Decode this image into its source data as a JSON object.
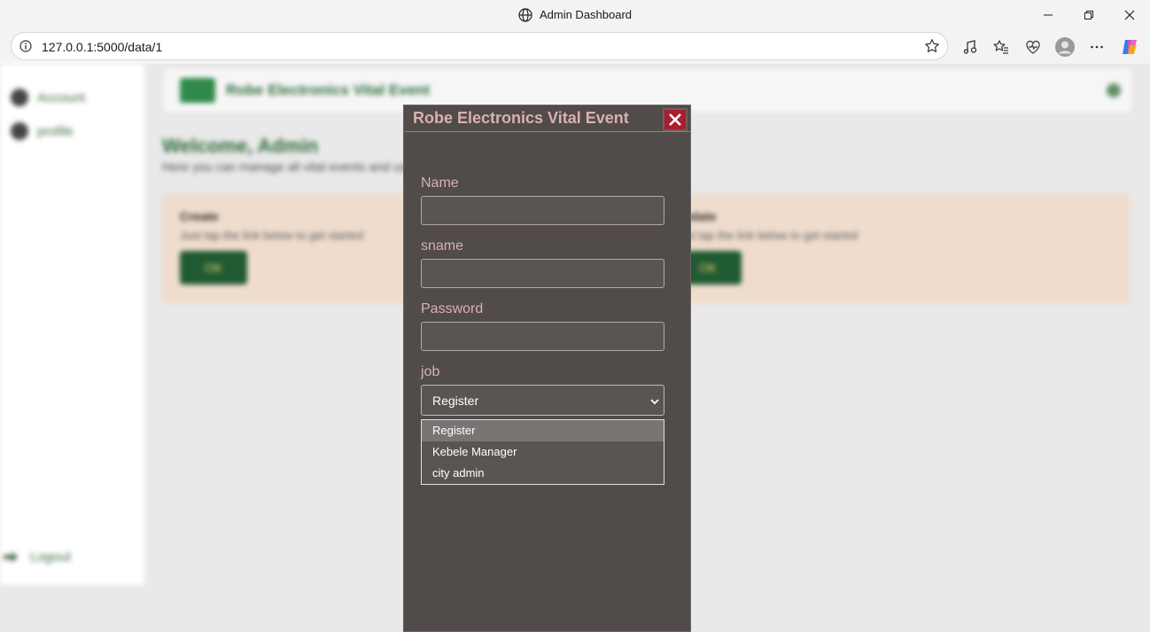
{
  "browser": {
    "window_title": "Admin Dashboard",
    "url": "127.0.0.1:5000/data/1"
  },
  "background_page": {
    "brand_title": "Robe Electronics Vital Event",
    "sidebar": {
      "items": [
        {
          "label": "Account",
          "icon": "user-icon"
        },
        {
          "label": "profile",
          "icon": "profile-icon"
        }
      ],
      "logout_label": "Logout"
    },
    "welcome_title": "Welcome, Admin",
    "welcome_subtitle": "Here you can manage all vital events and users",
    "cards": [
      {
        "title": "Create",
        "text": "Just tap the link below to get started",
        "button_label": "OK"
      },
      {
        "title": "Update",
        "text": "Just tap the link below to get started",
        "button_label": "OK"
      }
    ]
  },
  "modal": {
    "title": "Robe Electronics Vital Event",
    "fields": {
      "name_label": "Name",
      "sname_label": "sname",
      "password_label": "Password",
      "job_label": "job"
    },
    "job_select": {
      "selected": "Register",
      "options": [
        "Register",
        "Kebele Manager",
        "city admin"
      ]
    }
  },
  "colors": {
    "modal_bg": "#514b4a",
    "label_color": "#d8b2ae",
    "close_button": "#a91e2d"
  }
}
